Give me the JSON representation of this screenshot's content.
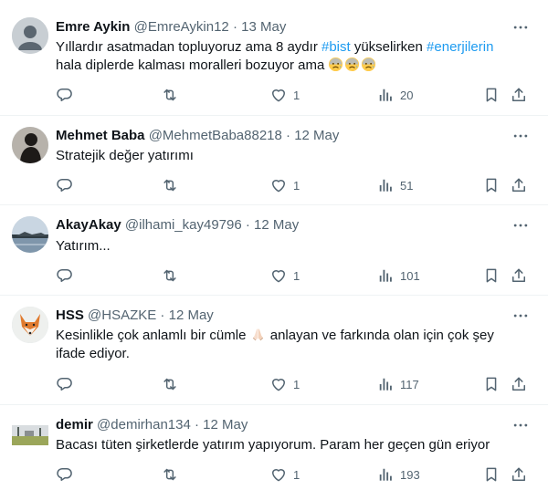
{
  "tweets": [
    {
      "name": "Emre Aykin",
      "handle": "@EmreAykin12",
      "date": "13 May",
      "text_before": "Yıllardır asatmadan topluyoruz ama 8 aydır ",
      "tag1": "#bist",
      "text_middle": " yükselirken ",
      "tag2": "#enerjilerin",
      "text_line2": "hala diplerde kalması moralleri bozuyor ama",
      "emojis": [
        "worried-face-emoji",
        "worried-face-emoji",
        "worried-face-emoji"
      ],
      "likes": "1",
      "views": "20"
    },
    {
      "name": "Mehmet Baba",
      "handle": "@MehmetBaba88218",
      "date": "12 May",
      "text": "Stratejik değer yatırımı",
      "likes": "1",
      "views": "51"
    },
    {
      "name": "AkayAkay",
      "handle": "@ilhami_kay49796",
      "date": "12 May",
      "text": "Yatırım...",
      "likes": "1",
      "views": "101"
    },
    {
      "name": "HSS",
      "handle": "@HSAZKE",
      "date": "12 May",
      "text_before": "Kesinlikle çok anlamlı bir cümle ",
      "emoji": "folded-hands-emoji",
      "text_after": " anlayan ve farkında olan için çok şey",
      "text_line2": "ifade ediyor.",
      "likes": "1",
      "views": "117"
    },
    {
      "name": "demir",
      "handle": "@demirhan134",
      "date": "12 May",
      "text": "Bacası tüten şirketlerde yatırım yapıyorum. Param her geçen gün eriyor",
      "likes": "1",
      "views": "193"
    }
  ],
  "separator": " · ",
  "colors": {
    "text": "#0f1419",
    "secondary": "#536471",
    "link": "#1d9bf0",
    "border": "#eff3f4"
  },
  "icons": [
    "more-icon",
    "reply-icon",
    "retweet-icon",
    "like-icon",
    "views-icon",
    "bookmark-icon",
    "share-icon"
  ]
}
